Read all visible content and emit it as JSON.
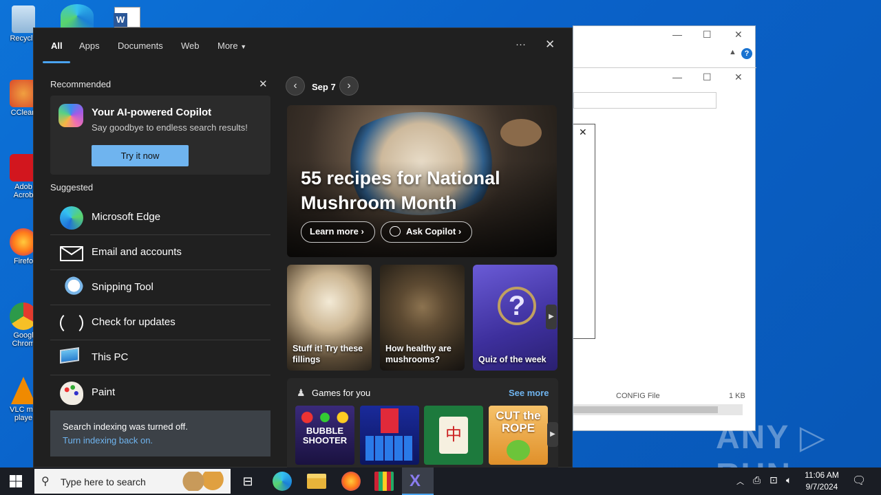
{
  "desktop": {
    "icons": [
      {
        "label": "Recycle",
        "color": "#9fc8e8"
      },
      {
        "label": "CClean",
        "color": "#d94a2a"
      },
      {
        "label": "Adob Acrob",
        "color": "#d2161e"
      },
      {
        "label": "Firefo",
        "color": "#ff7a1a"
      },
      {
        "label": "Googl Chrom",
        "color": "#2d9a4a"
      },
      {
        "label": "VLC me playe",
        "color": "#f08a00"
      }
    ]
  },
  "background_window": {
    "file_name": "CONFIG File",
    "file_size": "1 KB"
  },
  "tabs": {
    "all": "All",
    "apps": "Apps",
    "documents": "Documents",
    "web": "Web",
    "more": "More",
    "options": "···",
    "close": "✕"
  },
  "recommended": {
    "title": "Recommended",
    "card_title": "Your AI-powered Copilot",
    "card_subtitle": "Say goodbye to endless search results!",
    "button": "Try it now"
  },
  "suggested": {
    "title": "Suggested",
    "items": [
      {
        "label": "Microsoft Edge",
        "icon": "edge-icon"
      },
      {
        "label": "Email and accounts",
        "icon": "mail-icon"
      },
      {
        "label": "Snipping Tool",
        "icon": "snipping-tool-icon"
      },
      {
        "label": "Check for updates",
        "icon": "refresh-icon"
      },
      {
        "label": "This PC",
        "icon": "computer-icon"
      },
      {
        "label": "Paint",
        "icon": "paint-icon"
      }
    ]
  },
  "indexing": {
    "message": "Search indexing was turned off.",
    "link": "Turn indexing back on."
  },
  "feed": {
    "date": "Sep 7",
    "hero_title": "55 recipes for National Mushroom Month",
    "learn_more": "Learn more",
    "ask_copilot": "Ask Copilot",
    "tiles": [
      {
        "caption": "Stuff it! Try these fillings"
      },
      {
        "caption": "How healthy are mushrooms?"
      },
      {
        "caption": "Quiz of the week"
      }
    ],
    "games_title": "Games for you",
    "see_more": "See more",
    "games": [
      {
        "label": "BUBBLE SHOOTER"
      },
      {
        "label": "Blocks"
      },
      {
        "label": "Mahjong"
      },
      {
        "label": "CUT the ROPE"
      }
    ]
  },
  "taskbar": {
    "search_placeholder": "Type here to search",
    "time": "11:06 AM",
    "date": "9/7/2024"
  },
  "watermark": "ANY ▷ RUN",
  "colors": {
    "accent": "#4aa3f0",
    "panel_bg": "#202020",
    "link": "#6fb4ef",
    "see_more": "#6fb4ef"
  }
}
